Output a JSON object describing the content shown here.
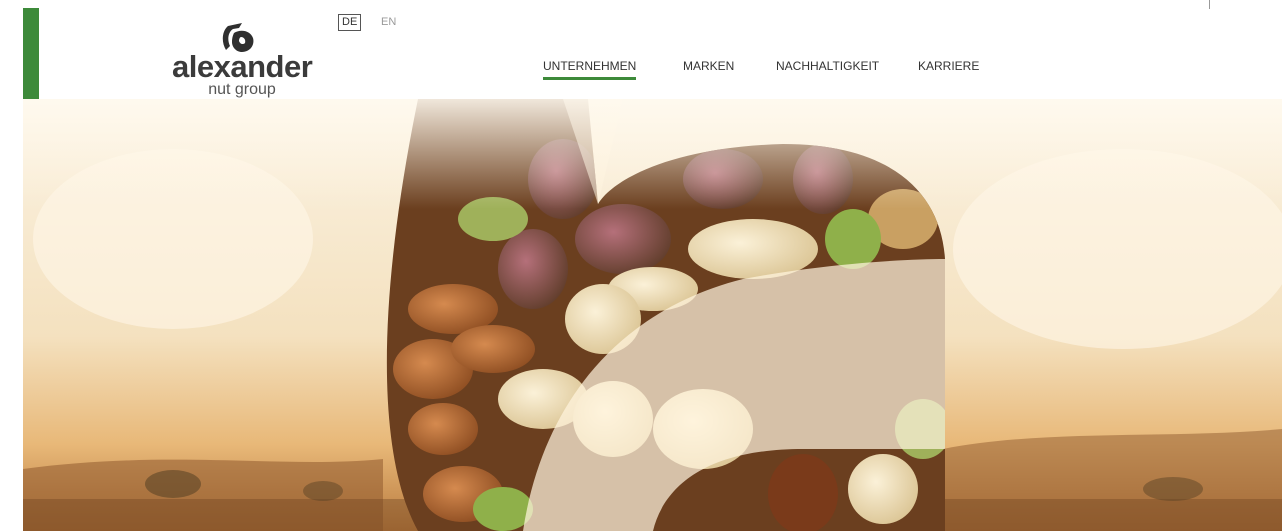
{
  "brand": {
    "name": "alexander",
    "tagline": "nut group",
    "accent_color": "#3d8a3a",
    "logo_icon": "alexander-logo-mark"
  },
  "languages": {
    "active": "DE",
    "other": "EN"
  },
  "nav": {
    "items": [
      {
        "label": "UNTERNEHMEN",
        "active": true
      },
      {
        "label": "MARKEN",
        "active": false
      },
      {
        "label": "NACHHALTIGKEIT",
        "active": false
      },
      {
        "label": "KARRIERE",
        "active": false
      }
    ]
  },
  "hero": {
    "image": "nuts-mix-in-logo-shape-over-landscape"
  }
}
